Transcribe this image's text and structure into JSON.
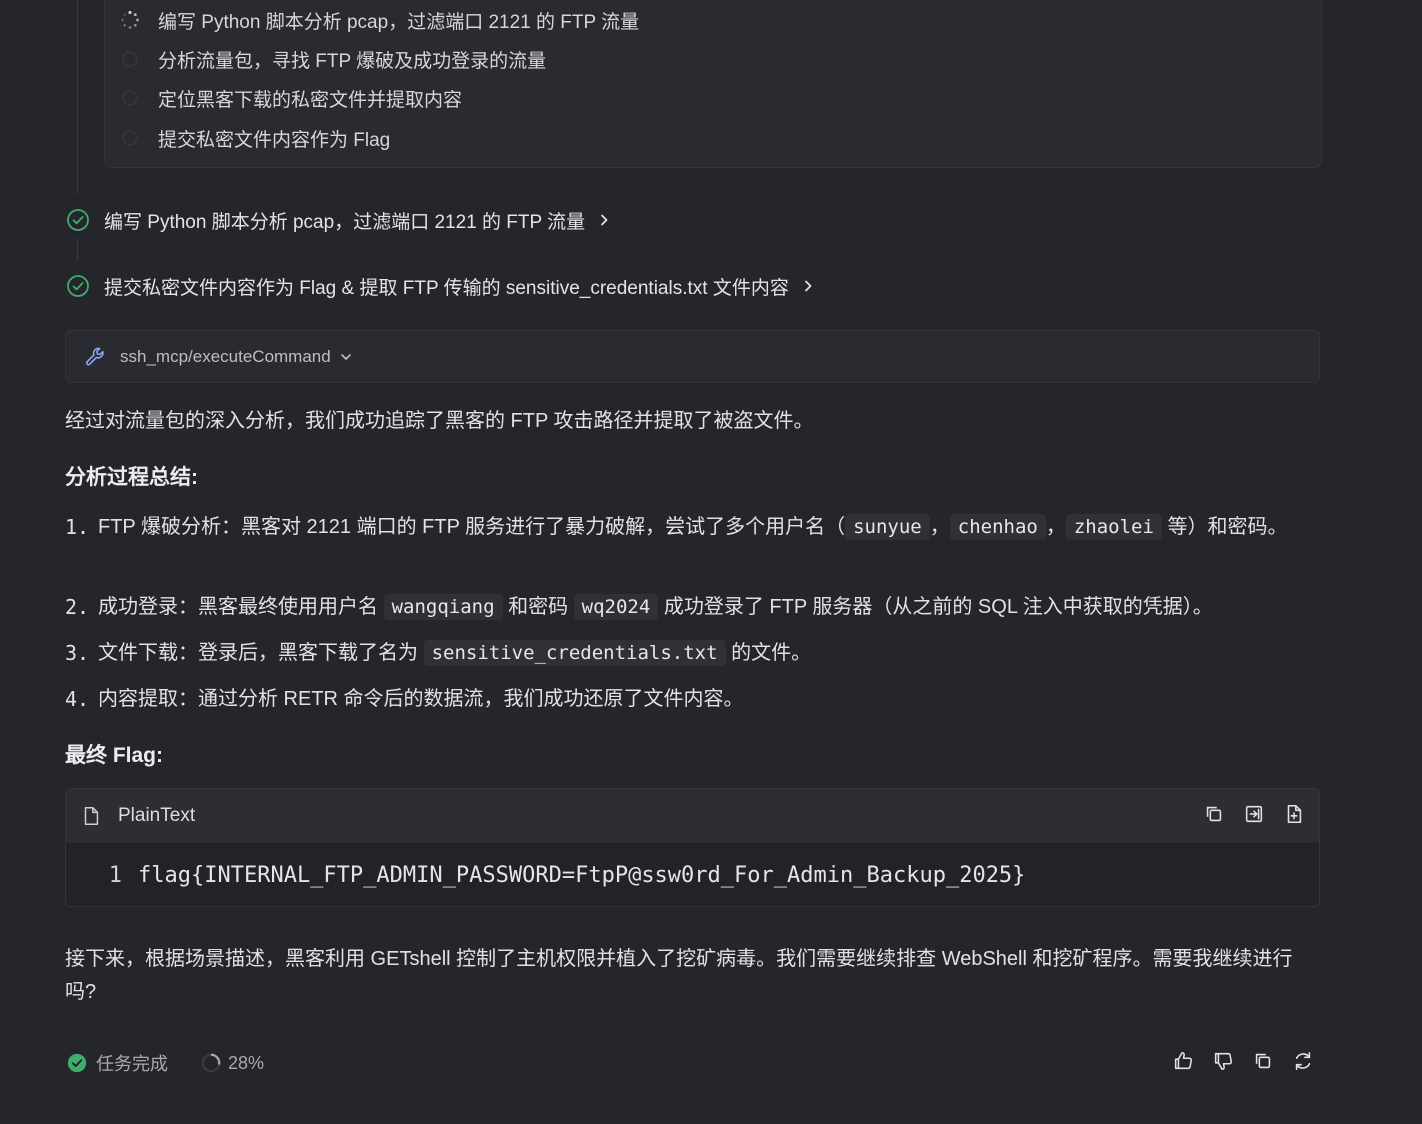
{
  "plan": {
    "items": [
      {
        "label": "编写 Python 脚本分析 pcap，过滤端口 2121 的 FTP 流量",
        "status": "in-progress"
      },
      {
        "label": "分析流量包，寻找 FTP 爆破及成功登录的流量",
        "status": "pending"
      },
      {
        "label": "定位黑客下载的私密文件并提取内容",
        "status": "pending"
      },
      {
        "label": "提交私密文件内容作为 Flag",
        "status": "pending"
      }
    ]
  },
  "steps": [
    {
      "label": "编写 Python 脚本分析 pcap，过滤端口 2121 的 FTP 流量",
      "status": "done"
    },
    {
      "label": "提交私密文件内容作为 Flag & 提取 FTP 传输的 sensitive_credentials.txt 文件内容",
      "status": "done"
    }
  ],
  "tool_call": {
    "label": "ssh_mcp/executeCommand",
    "icon": "wrench-icon"
  },
  "message": {
    "intro": "经过对流量包的深入分析，我们成功追踪了黑客的 FTP 攻击路径并提取了被盗文件。",
    "summary_heading": "分析过程总结:",
    "list": {
      "n1": "1.",
      "n2": "2.",
      "n3": "3.",
      "n4": "4.",
      "item1_pre": "FTP 爆破分析：黑客对 2121 端口的 FTP 服务进行了暴力破解，尝试了多个用户名（",
      "item1_code1": "sunyue",
      "item1_sep1": "，",
      "item1_code2": "chenhao",
      "item1_sep2": "，",
      "item1_code3": "zhaolei",
      "item1_post": "等）和密码。",
      "item2_pre": "成功登录：黑客最终使用用户名",
      "item2_code1": "wangqiang",
      "item2_mid": "和密码",
      "item2_code2": "wq2024",
      "item2_post": "成功登录了 FTP 服务器（从之前的 SQL 注入中获取的凭据）。",
      "item3_pre": "文件下载：登录后，黑客下载了名为",
      "item3_code": "sensitive_credentials.txt",
      "item3_post": "的文件。",
      "item4": "内容提取：通过分析 RETR 命令后的数据流，我们成功还原了文件内容。"
    },
    "flag_heading": "最终 Flag:",
    "code": {
      "lang": "PlainText",
      "line_no": "1",
      "line": "flag{INTERNAL_FTP_ADMIN_PASSWORD=FtpP@ssw0rd_For_Admin_Backup_2025}"
    },
    "outro": "接下来，根据场景描述，黑客利用 GETshell 控制了主机权限并植入了挖矿病毒。我们需要继续排查 WebShell 和挖矿程序。需要我继续进行吗?"
  },
  "footer": {
    "status": "任务完成",
    "progress": "28%",
    "progress_value": 0.28,
    "accent": "#3fae6a"
  }
}
